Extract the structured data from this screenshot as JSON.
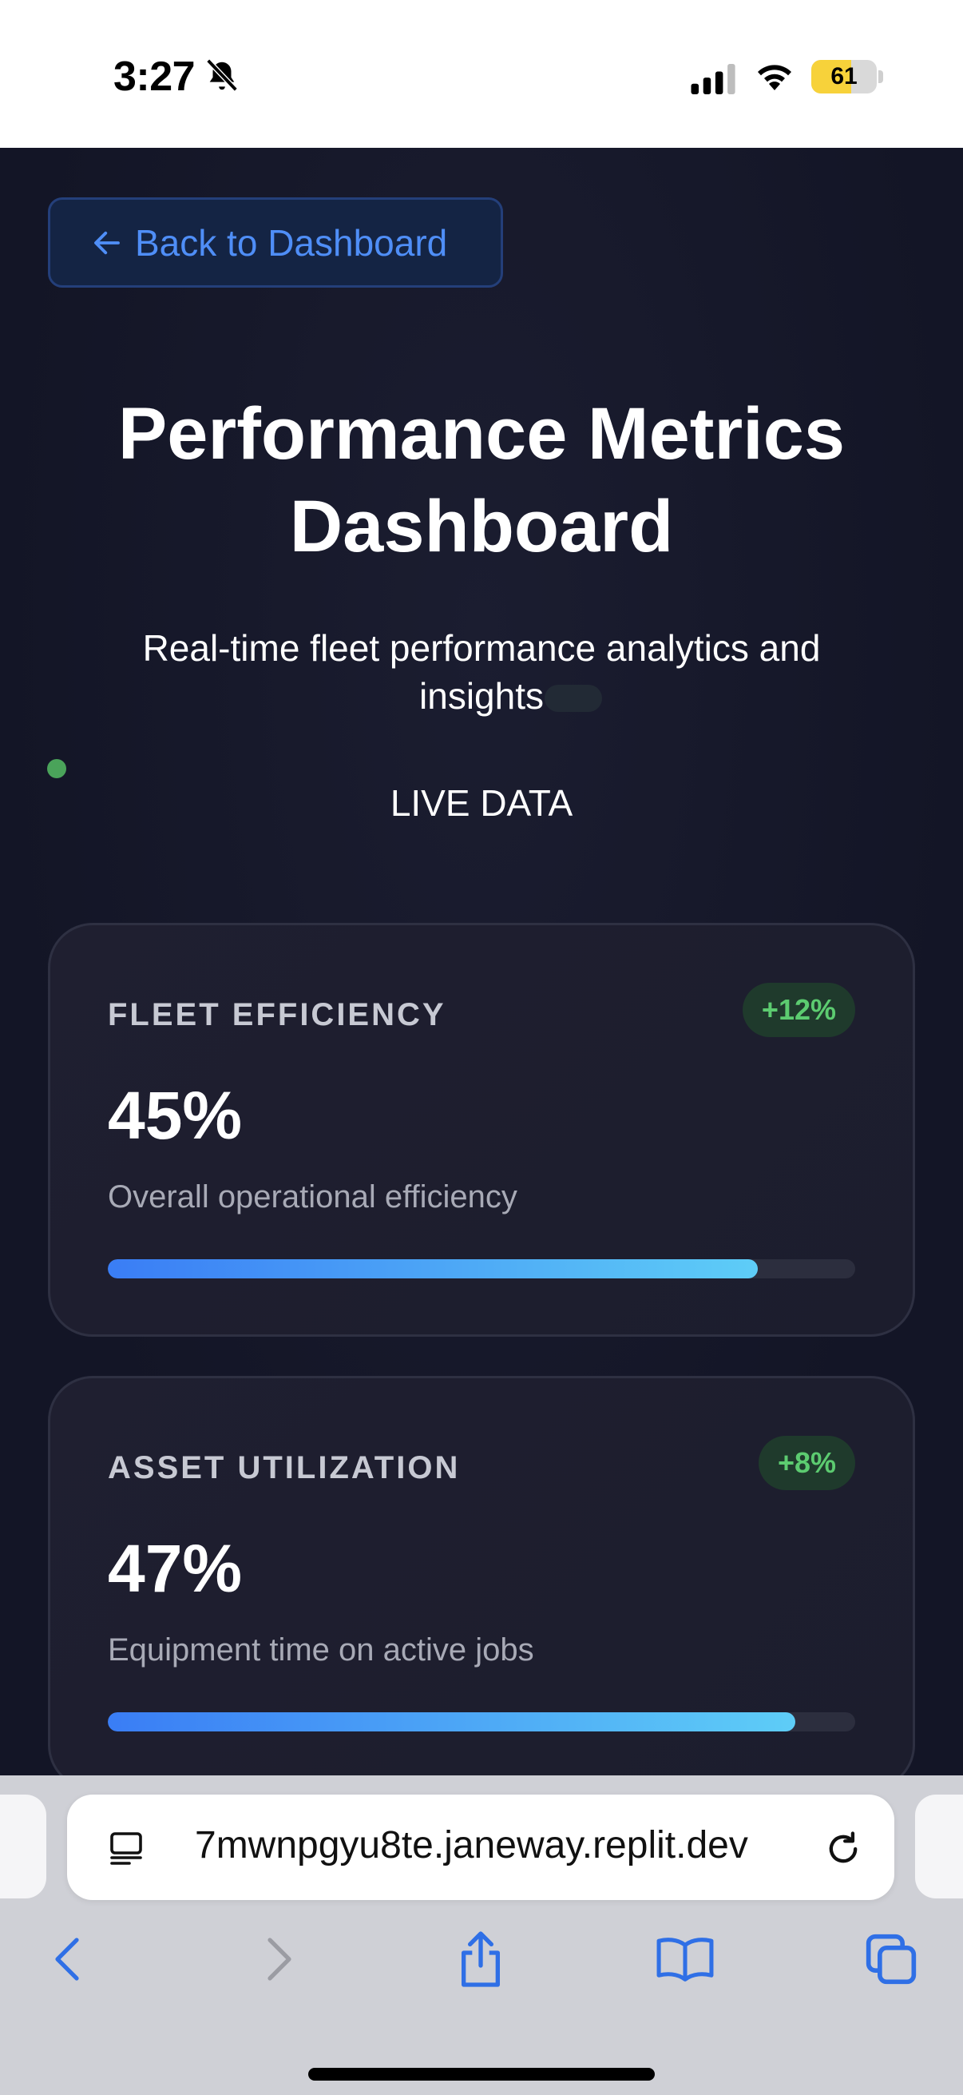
{
  "status_bar": {
    "time": "3:27",
    "battery_level": "61",
    "battery_fraction": 0.61,
    "icons": [
      "bell-slash-icon",
      "cellular-signal-icon",
      "wifi-icon",
      "battery-icon"
    ]
  },
  "back_button": {
    "label": "Back to Dashboard",
    "icon": "arrow-left-icon"
  },
  "header": {
    "title": "Performance Metrics Dashboard",
    "subtitle": "Real-time fleet performance analytics and insights",
    "live_label": "LIVE DATA",
    "live_color": "#4aa35a"
  },
  "metrics": [
    {
      "label": "FLEET EFFICIENCY",
      "badge": "+12%",
      "value": "45%",
      "description": "Overall operational efficiency",
      "progress_fraction": 0.87
    },
    {
      "label": "ASSET UTILIZATION",
      "badge": "+8%",
      "value": "47%",
      "description": "Equipment time on active jobs",
      "progress_fraction": 0.92
    }
  ],
  "colors": {
    "background": "#131526",
    "accent": "#4f8ef7",
    "badge_text": "#5ccb70",
    "progress_start": "#3a7df5",
    "progress_end": "#5ecdf7"
  },
  "browser": {
    "url": "7mwnpgyu8te.janeway.replit.dev",
    "icons": [
      "reader-mode-icon",
      "reload-icon",
      "back-arrow-icon",
      "forward-arrow-icon",
      "share-icon",
      "bookmarks-icon",
      "tabs-icon"
    ]
  }
}
